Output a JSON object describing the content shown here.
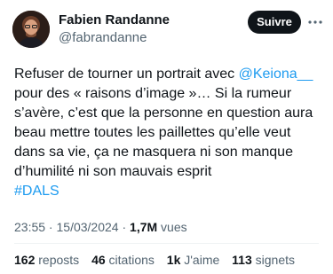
{
  "author": {
    "display_name": "Fabien Randanne",
    "handle": "@fabrandanne"
  },
  "follow_label": "Suivre",
  "more_icon": "more-horizontal-icon",
  "tweet": {
    "part1": "Refuser de tourner un portrait avec ",
    "mention": "@Keiona__",
    "part2": "\npour des « raisons d’image »… Si la rumeur s’avère, c’est que la personne en question aura beau mettre toutes les paillettes qu’elle veut dans sa vie, ça ne masquera ni son manque d’humilité ni son mauvais esprit\n",
    "hashtag": "#DALS"
  },
  "meta": {
    "time": "23:55",
    "separator1": " · ",
    "date": "15/03/2024",
    "separator2": " · ",
    "views_count": "1,7M",
    "views_label": " vues"
  },
  "stats": [
    {
      "count": "162",
      "label": " reposts"
    },
    {
      "count": "46",
      "label": " citations"
    },
    {
      "count": "1k",
      "label": " J'aime"
    },
    {
      "count": "113",
      "label": " signets"
    }
  ],
  "colors": {
    "text": "#0f1419",
    "secondary": "#536471",
    "link": "#1d9bf0",
    "button": "#0f1419"
  }
}
